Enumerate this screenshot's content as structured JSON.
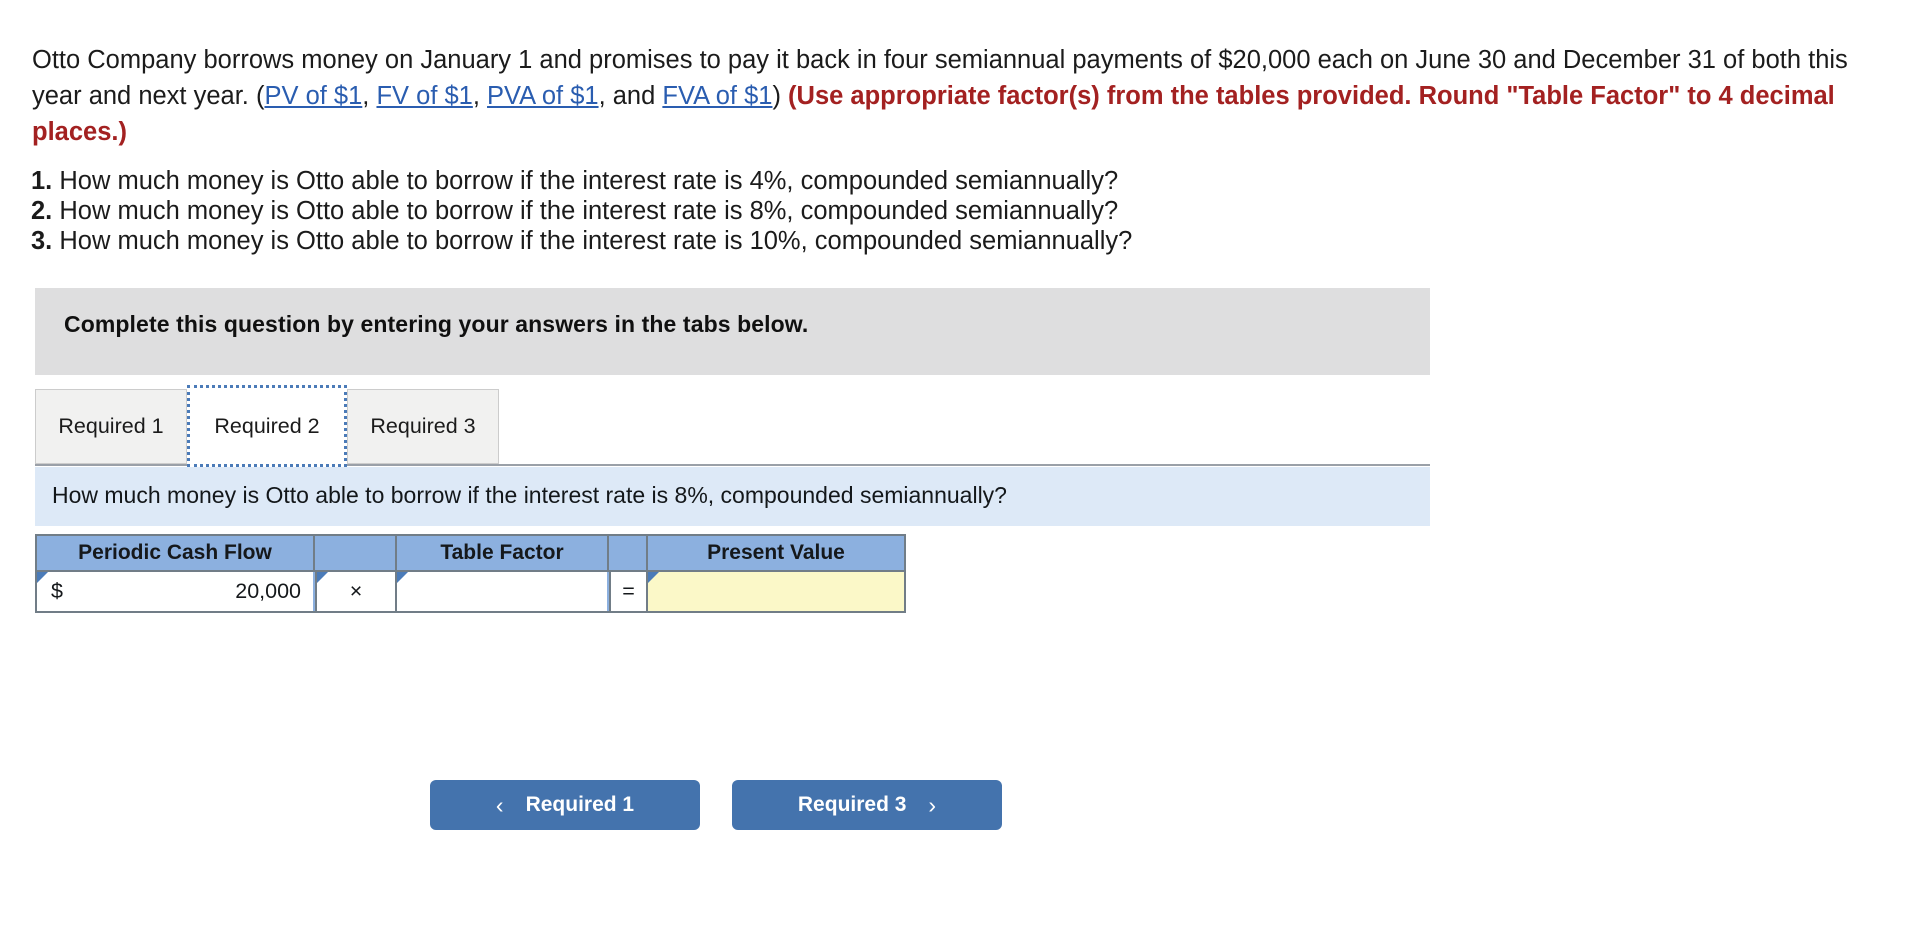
{
  "problem": {
    "part1": "Otto Company borrows money on January 1 and promises to pay it back in four semiannual payments of $20,000 each on June 30 and December 31 of both this year and next year. (",
    "link1": "PV of $1",
    "sep1": ", ",
    "link2": "FV of $1",
    "sep2": ", ",
    "link3": "PVA of $1",
    "sep3": ", and ",
    "link4": "FVA of $1",
    "part2": ") ",
    "emphasis": "(Use appropriate factor(s) from the tables provided. Round \"Table Factor\" to 4 decimal places.)"
  },
  "questions": [
    {
      "num": "1.",
      "text": " How much money is Otto able to borrow if the interest rate is 4%, compounded semiannually?"
    },
    {
      "num": "2.",
      "text": " How much money is Otto able to borrow if the interest rate is 8%, compounded semiannually?"
    },
    {
      "num": "3.",
      "text": " How much money is Otto able to borrow if the interest rate is 10%, compounded semiannually?"
    }
  ],
  "banner": {
    "instruction": "Complete this question by entering your answers in the tabs below."
  },
  "tabs": [
    {
      "label": "Required 1",
      "active": false
    },
    {
      "label": "Required 2",
      "active": true
    },
    {
      "label": "Required 3",
      "active": false
    }
  ],
  "sub_question": "How much money is Otto able to borrow if the interest rate is 8%, compounded semiannually?",
  "calc_table": {
    "headers": [
      "Periodic Cash Flow",
      "",
      "Table Factor",
      "",
      "Present Value"
    ],
    "row": {
      "currency_symbol": "$",
      "cash_flow": "20,000",
      "operator1": "×",
      "table_factor": "",
      "operator2": "=",
      "present_value": ""
    }
  },
  "nav": {
    "prev_label": "Required 1",
    "prev_icon": "chevron-left-icon",
    "prev_glyph": "‹",
    "next_label": "Required 3",
    "next_icon": "chevron-right-icon",
    "next_glyph": "›"
  },
  "colors": {
    "link": "#2a5db0",
    "emphasis_red": "#a32121",
    "banner_gray": "#dededf",
    "sub_question_blue": "#dde9f7",
    "table_header_blue": "#8cb0df",
    "answer_yellow": "#fbf8c8",
    "button_blue": "#4473ad",
    "focus_outline_blue": "#4b7bb8"
  }
}
